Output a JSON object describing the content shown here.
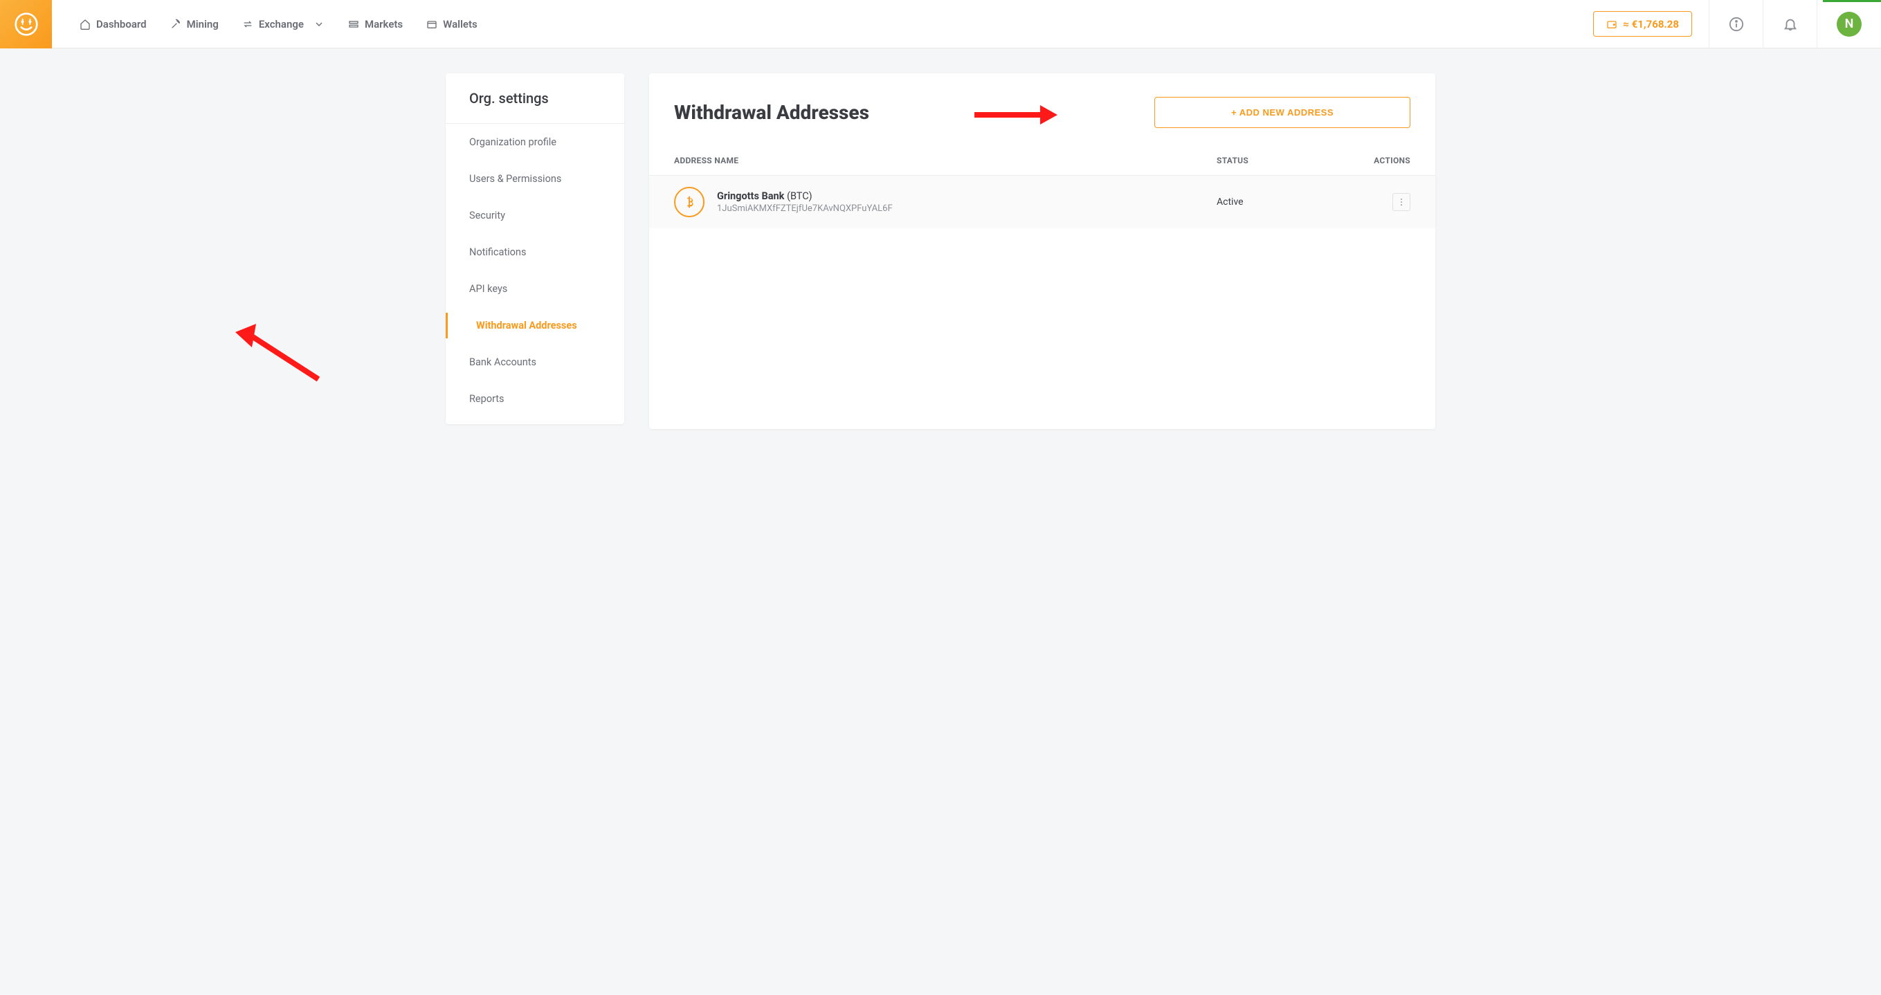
{
  "nav": {
    "dashboard": "Dashboard",
    "mining": "Mining",
    "exchange": "Exchange",
    "markets": "Markets",
    "wallets": "Wallets"
  },
  "balance": "≈ €1,768.28",
  "avatar_letter": "N",
  "sidebar": {
    "title": "Org. settings",
    "items": [
      "Organization profile",
      "Users & Permissions",
      "Security",
      "Notifications",
      "API keys",
      "Withdrawal Addresses",
      "Bank Accounts",
      "Reports"
    ],
    "active_index": 5
  },
  "main": {
    "title": "Withdrawal Addresses",
    "add_button": "+ ADD NEW ADDRESS",
    "columns": {
      "name": "ADDRESS NAME",
      "status": "STATUS",
      "actions": "ACTIONS"
    },
    "rows": [
      {
        "name": "Gringotts Bank",
        "coin": "(BTC)",
        "address": "1JuSmiAKMXfFZTEjfUe7KAvNQXPFuYAL6F",
        "status": "Active"
      }
    ]
  }
}
